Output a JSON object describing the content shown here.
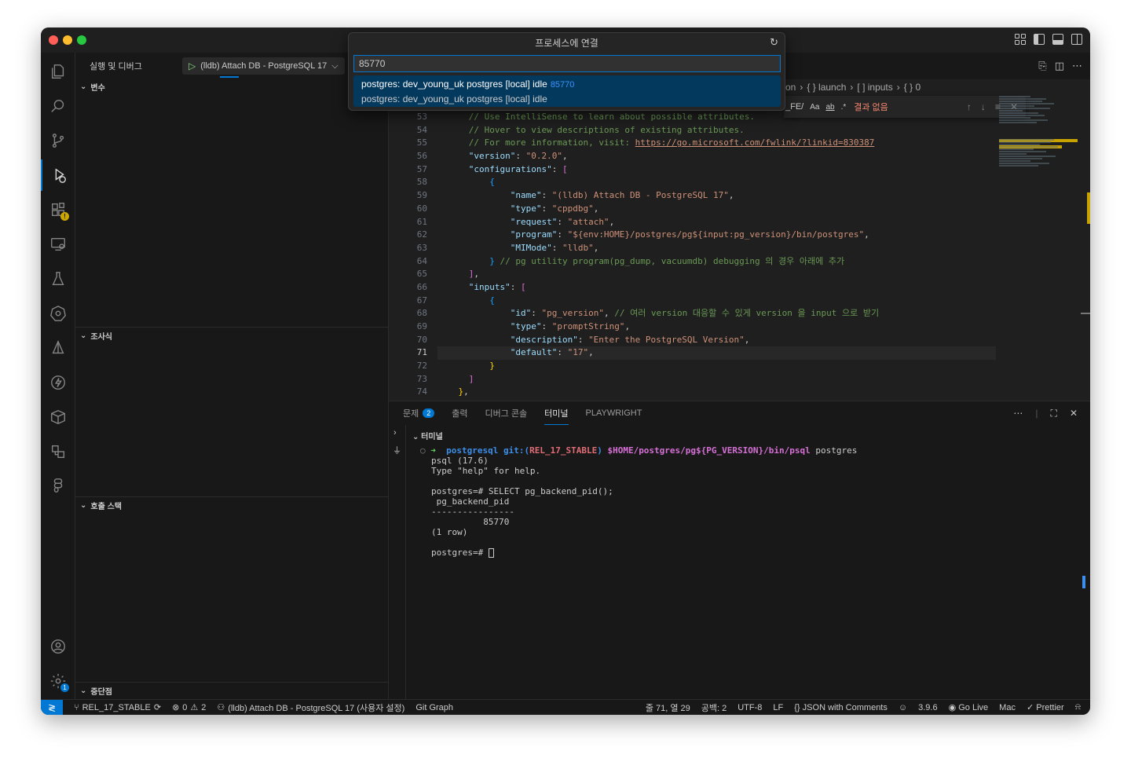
{
  "quickpick": {
    "title": "프로세스에 연결",
    "input_value": "85770",
    "item_label": "postgres: dev_young_uk postgres [local] idle",
    "item_pid": "85770",
    "item_detail": "postgres: dev_young_uk postgres [local] idle"
  },
  "sidebar": {
    "title": "실행 및 디버그",
    "run_config": "(lldb) Attach DB - PostgreSQL 17",
    "sections": {
      "variables": "변수",
      "watch": "조사식",
      "callstack": "호출 스택",
      "breakpoints": "중단점"
    }
  },
  "breadcrumb": {
    "items": [
      "on",
      "{ } launch",
      "[ ] inputs",
      "{ } 0"
    ]
  },
  "find": {
    "value": "_FE/",
    "opt_case": "Aa",
    "opt_word": "ab",
    "opt_regex": ".*",
    "no_results": "결과 없음"
  },
  "editor": {
    "line_numbers": [
      "53",
      "54",
      "55",
      "56",
      "57",
      "58",
      "59",
      "60",
      "61",
      "62",
      "63",
      "64",
      "65",
      "66",
      "67",
      "68",
      "69",
      "70",
      "71",
      "72",
      "73",
      "74"
    ],
    "current_line": "71",
    "lines": {
      "l53": "// Use IntelliSense to learn about possible attributes.",
      "l54": "// Hover to view descriptions of existing attributes.",
      "l55_pre": "// For more information, visit: ",
      "l55_link": "https://go.microsoft.com/fwlink/?linkid=830387",
      "version_key": "\"version\"",
      "version_val": "\"0.2.0\"",
      "configurations_key": "\"configurations\"",
      "name_key": "\"name\"",
      "name_val": "\"(lldb) Attach DB - PostgreSQL 17\"",
      "type_key": "\"type\"",
      "type_val": "\"cppdbg\"",
      "request_key": "\"request\"",
      "request_val": "\"attach\"",
      "program_key": "\"program\"",
      "program_val": "\"${env:HOME}/postgres/pg${input:pg_version}/bin/postgres\"",
      "mimode_key": "\"MIMode\"",
      "mimode_val": "\"lldb\"",
      "l64_comment": "// pg utility program(pg_dump, vacuumdb) debugging 의 경우 아래에 추가",
      "inputs_key": "\"inputs\"",
      "id_key": "\"id\"",
      "id_val": "\"pg_version\"",
      "l68_comment": "// 여러 version 대응할 수 있게 version 을 input 으로 받기",
      "itype_key": "\"type\"",
      "itype_val": "\"promptString\"",
      "desc_key": "\"description\"",
      "desc_val": "\"Enter the PostgreSQL Version\"",
      "default_key": "\"default\"",
      "default_val": "\"17\""
    }
  },
  "panel": {
    "tabs": {
      "problems": "문제",
      "problems_count": "2",
      "output": "출력",
      "debug_console": "디버그 콘솔",
      "terminal": "터미널",
      "playwright": "PLAYWRIGHT"
    },
    "terminal_header": "터미널",
    "terminal": {
      "prompt_repo": "postgresql",
      "prompt_git": "git:(",
      "prompt_branch": "REL_17_STABLE",
      "prompt_git_close": ")",
      "prompt_cmd": "$HOME/postgres/pg${PG_VERSION}/bin/psql",
      "prompt_arg": " postgres",
      "out1": "psql (17.6)",
      "out2": "Type \"help\" for help.",
      "out3": "postgres=# SELECT pg_backend_pid();",
      "out4": " pg_backend_pid",
      "out5": "----------------",
      "out6": "          85770",
      "out7": "(1 row)",
      "out8": "postgres=# "
    }
  },
  "statusbar": {
    "branch": "REL_17_STABLE",
    "errors": "0",
    "warnings": "2",
    "debug_config": "(lldb) Attach DB - PostgreSQL 17 (사용자 설정)",
    "git_graph": "Git Graph",
    "position": "줄 71, 열 29",
    "spaces": "공백: 2",
    "encoding": "UTF-8",
    "eol": "LF",
    "language": "JSON with Comments",
    "version": "3.9.6",
    "go_live": "Go Live",
    "mac": "Mac",
    "prettier": "Prettier"
  }
}
